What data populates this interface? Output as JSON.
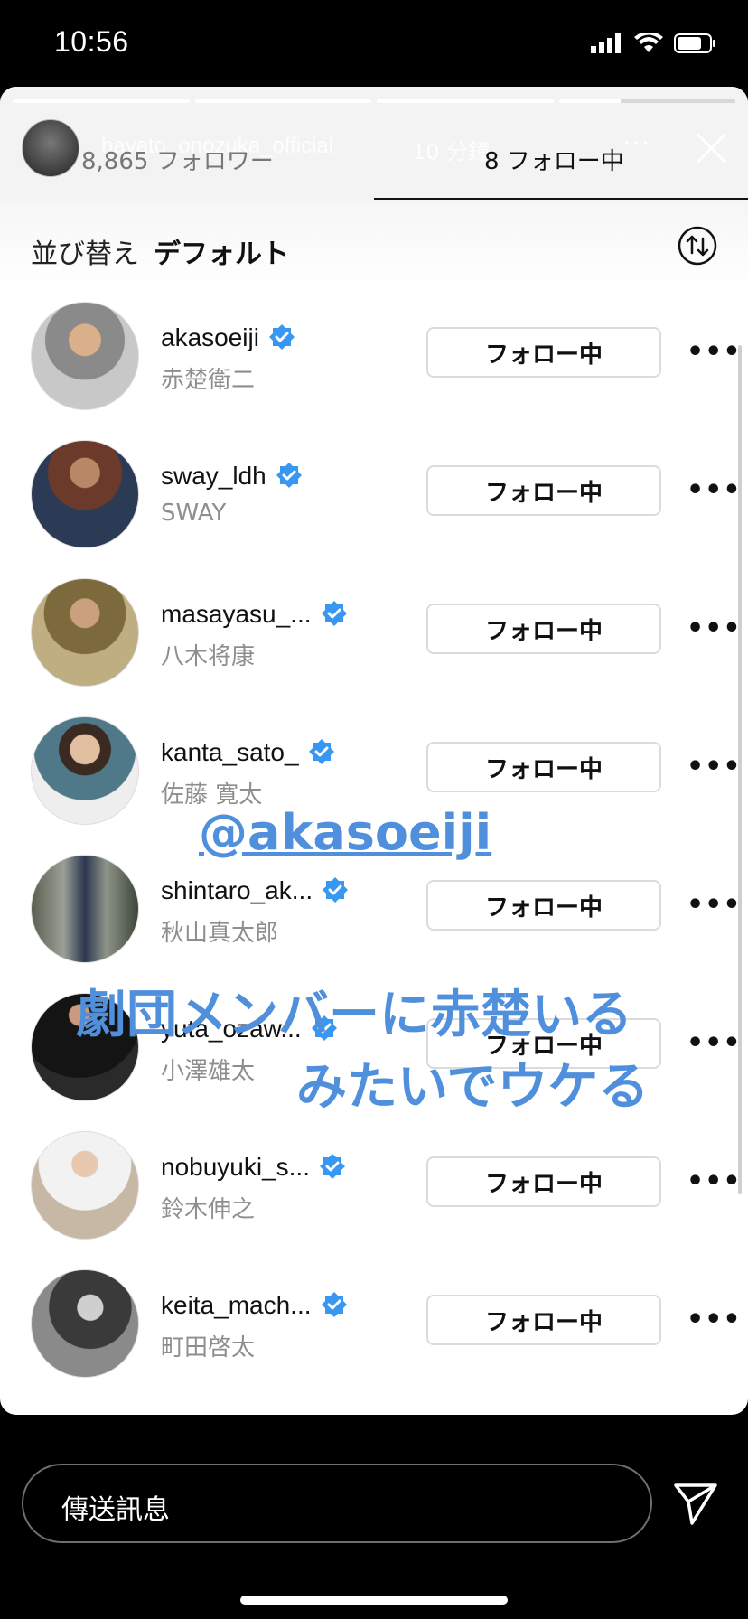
{
  "status_bar": {
    "time": "10:56"
  },
  "story": {
    "username": "hayato_onozuka_official",
    "time_ago": "10 分鐘",
    "more": "···"
  },
  "tabs": {
    "followers": "8,865 フォロワー",
    "following": "8 フォロー中"
  },
  "sort": {
    "label": "並び替え",
    "value": "デフォルト"
  },
  "accounts": [
    {
      "username": "akasoeiji",
      "name": "赤楚衛二",
      "button": "フォロー中"
    },
    {
      "username": "sway_ldh",
      "name": "SWAY",
      "button": "フォロー中"
    },
    {
      "username": "masayasu_...",
      "name": "八木将康",
      "button": "フォロー中"
    },
    {
      "username": "kanta_sato_",
      "name": "佐藤 寛太",
      "button": "フォロー中"
    },
    {
      "username": "shintaro_ak...",
      "name": "秋山真太郎",
      "button": "フォロー中"
    },
    {
      "username": "yuta_ozaw...",
      "name": "小澤雄太",
      "button": "フォロー中"
    },
    {
      "username": "nobuyuki_s...",
      "name": "鈴木伸之",
      "button": "フォロー中"
    },
    {
      "username": "keita_mach...",
      "name": "町田啓太",
      "button": "フォロー中"
    }
  ],
  "overlay": {
    "mention": "@akasoeiji",
    "line1": "劇団メンバーに赤楚いる",
    "line2": "みたいでウケる"
  },
  "message": {
    "placeholder": "傳送訊息"
  },
  "colors": {
    "accent": "#4f8fdc",
    "verified": "#3897f0"
  }
}
